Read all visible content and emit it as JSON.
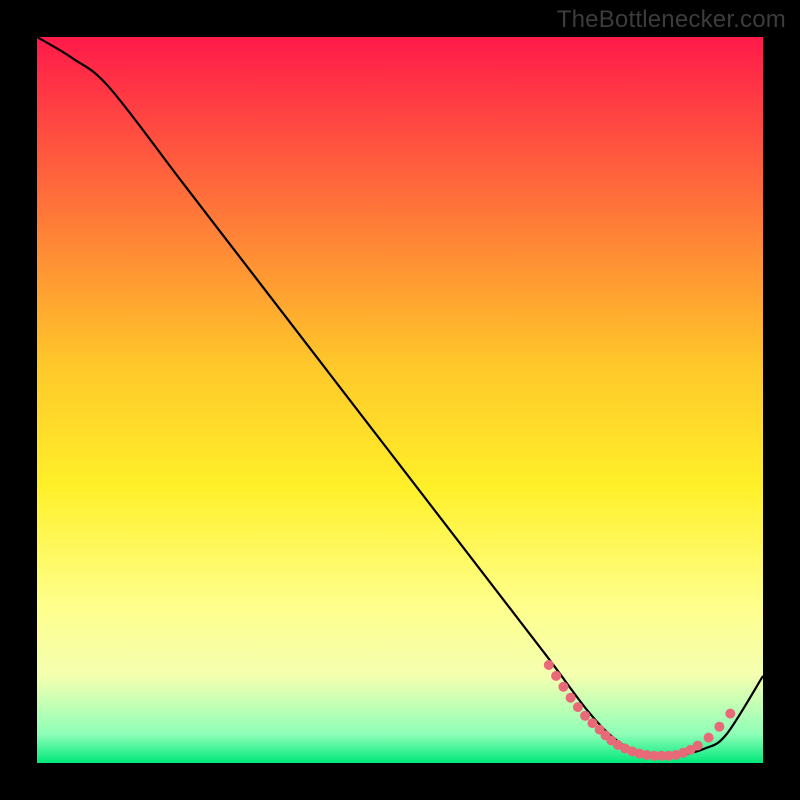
{
  "watermark": "TheBottlenecker.com",
  "chart_data": {
    "type": "line",
    "title": "",
    "xlabel": "",
    "ylabel": "",
    "xlim": [
      0,
      100
    ],
    "ylim": [
      0,
      100
    ],
    "background": {
      "stops": [
        {
          "pct": 0,
          "color": "#ff1a4a"
        },
        {
          "pct": 45,
          "color": "#ffc72a"
        },
        {
          "pct": 62,
          "color": "#fff029"
        },
        {
          "pct": 78,
          "color": "#ffff8a"
        },
        {
          "pct": 88,
          "color": "#f4ffb0"
        },
        {
          "pct": 96,
          "color": "#8fffb8"
        },
        {
          "pct": 100,
          "color": "#00e87a"
        }
      ]
    },
    "series": [
      {
        "name": "curve",
        "x": [
          0,
          5,
          10,
          20,
          30,
          40,
          50,
          60,
          70,
          76,
          80,
          84,
          88,
          92,
          95,
          100
        ],
        "y": [
          100,
          97,
          93,
          80,
          67,
          54,
          41,
          28,
          15,
          7,
          3,
          1,
          1,
          2,
          4,
          12
        ]
      }
    ],
    "markers": [
      {
        "x": 70.5,
        "y": 13.5
      },
      {
        "x": 71.5,
        "y": 12.0
      },
      {
        "x": 72.5,
        "y": 10.5
      },
      {
        "x": 73.5,
        "y": 9.0
      },
      {
        "x": 74.5,
        "y": 7.7
      },
      {
        "x": 75.5,
        "y": 6.5
      },
      {
        "x": 76.5,
        "y": 5.5
      },
      {
        "x": 77.5,
        "y": 4.6
      },
      {
        "x": 78.3,
        "y": 3.8
      },
      {
        "x": 79.1,
        "y": 3.1
      },
      {
        "x": 80.0,
        "y": 2.5
      },
      {
        "x": 81.0,
        "y": 2.0
      },
      {
        "x": 82.0,
        "y": 1.6
      },
      {
        "x": 83.0,
        "y": 1.3
      },
      {
        "x": 84.0,
        "y": 1.1
      },
      {
        "x": 85.0,
        "y": 1.0
      },
      {
        "x": 86.0,
        "y": 1.0
      },
      {
        "x": 87.0,
        "y": 1.0
      },
      {
        "x": 88.0,
        "y": 1.1
      },
      {
        "x": 89.0,
        "y": 1.4
      },
      {
        "x": 90.0,
        "y": 1.8
      },
      {
        "x": 91.0,
        "y": 2.4
      },
      {
        "x": 92.5,
        "y": 3.5
      },
      {
        "x": 94.0,
        "y": 5.0
      },
      {
        "x": 95.5,
        "y": 6.8
      }
    ],
    "marker_style": {
      "color": "#e86a78",
      "radius": 5
    }
  }
}
